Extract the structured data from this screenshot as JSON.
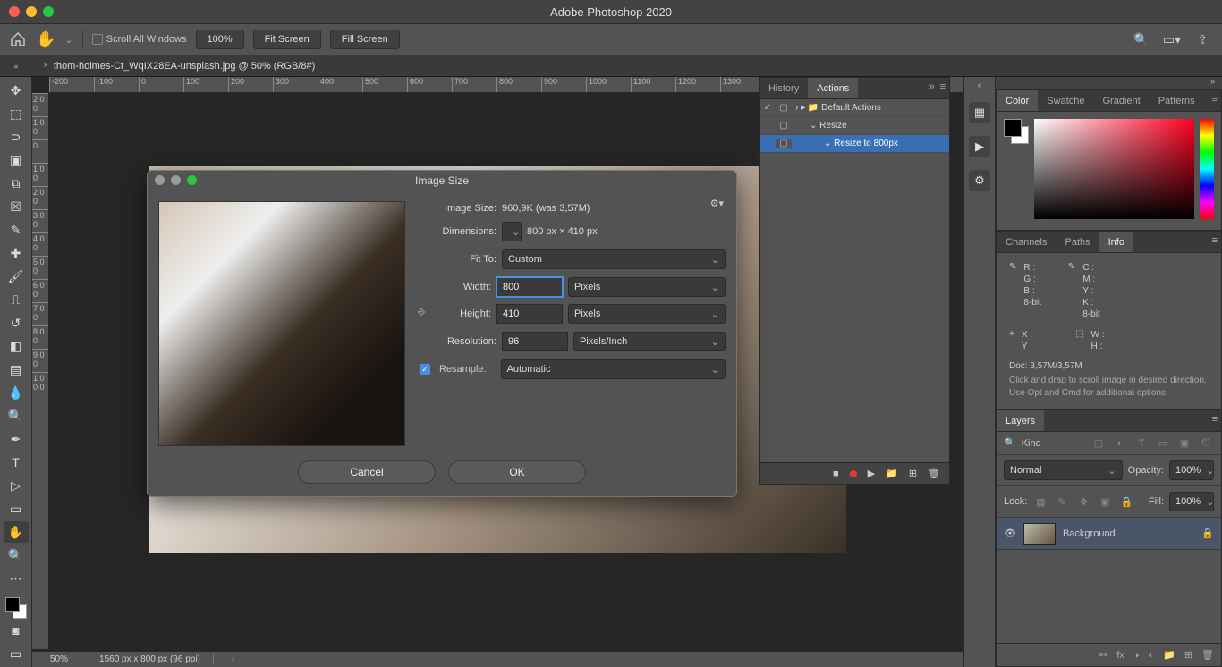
{
  "app": {
    "title": "Adobe Photoshop 2020"
  },
  "optionsbar": {
    "scroll_all": "Scroll All Windows",
    "zoom": "100%",
    "fit_screen": "Fit Screen",
    "fill_screen": "Fill Screen"
  },
  "document": {
    "tab": "thom-holmes-Ct_WqIX28EA-unsplash.jpg @ 50% (RGB/8#)"
  },
  "ruler_h": [
    "-200",
    "-100",
    "0",
    "100",
    "200",
    "300",
    "400",
    "500",
    "600",
    "700",
    "800",
    "900",
    "1000",
    "1100",
    "1200",
    "1300"
  ],
  "ruler_v": [
    "2 0 0",
    "1 0 0",
    "0",
    "1 0 0",
    "2 0 0",
    "3 0 0",
    "4 0 0",
    "5 0 0",
    "6 0 0",
    "7 0 0",
    "8 0 0",
    "9 0 0",
    "1 0 0 0"
  ],
  "status": {
    "zoom": "50%",
    "dims": "1560 px x 800 px (96 ppi)"
  },
  "history_panel": {
    "tabs": {
      "history": "History",
      "actions": "Actions"
    },
    "rows": [
      {
        "label": "Default Actions",
        "checked": true,
        "folder": true,
        "indent": 0
      },
      {
        "label": "Resize",
        "indent": 1,
        "expanded": true
      },
      {
        "label": "Resize to 800px",
        "indent": 2,
        "selected": true
      }
    ]
  },
  "color_panel": {
    "tabs": [
      "Color",
      "Swatche",
      "Gradient",
      "Patterns"
    ]
  },
  "info_panel": {
    "tabs": [
      "Channels",
      "Paths",
      "Info"
    ],
    "rgb": {
      "R": "R :",
      "G": "G :",
      "B": "B :",
      "bit": "8-bit"
    },
    "cmyk": {
      "C": "C :",
      "M": "M :",
      "Y": "Y :",
      "K": "K :",
      "bit": "8-bit"
    },
    "xy": {
      "X": "X :",
      "Y": "Y :"
    },
    "wh": {
      "W": "W :",
      "H": "H :"
    },
    "doc": "Doc: 3,57M/3,57M",
    "hint": "Click and drag to scroll image in desired direction.  Use Opt and Cmd for additional options"
  },
  "layers_panel": {
    "tab": "Layers",
    "kind": "Kind",
    "blend": "Normal",
    "opacity_label": "Opacity:",
    "opacity": "100%",
    "lock": "Lock:",
    "fill_label": "Fill:",
    "fill": "100%",
    "layer": "Background"
  },
  "dialog": {
    "title": "Image Size",
    "image_size_label": "Image Size:",
    "image_size_value": "960,9K (was 3,57M)",
    "dimensions_label": "Dimensions:",
    "dimensions_value": "800 px  ×  410 px",
    "fit_to_label": "Fit To:",
    "fit_to_value": "Custom",
    "width_label": "Width:",
    "width_value": "800",
    "width_unit": "Pixels",
    "height_label": "Height:",
    "height_value": "410",
    "height_unit": "Pixels",
    "resolution_label": "Resolution:",
    "resolution_value": "96",
    "resolution_unit": "Pixels/Inch",
    "resample_label": "Resample:",
    "resample_value": "Automatic",
    "cancel": "Cancel",
    "ok": "OK"
  }
}
